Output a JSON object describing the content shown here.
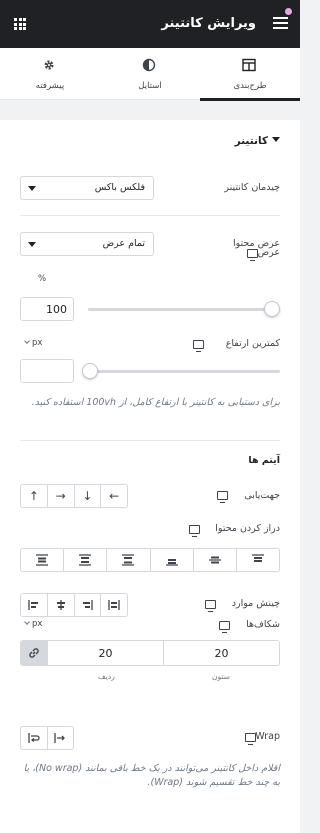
{
  "header": {
    "title": "ویرایش کانتینر"
  },
  "tabs": [
    {
      "label": "طرح‌بندی",
      "icon": "layout-icon",
      "active": true
    },
    {
      "label": "استایل",
      "icon": "contrast-icon",
      "active": false
    },
    {
      "label": "پیشرفته",
      "icon": "gear-icon",
      "active": false
    }
  ],
  "section": {
    "title": "کانتینر"
  },
  "container_layout": {
    "label": "چیدمان کانتینر",
    "value": "فلکس باکس"
  },
  "content_width": {
    "label": "عرض محتوا",
    "value": "تمام عرض"
  },
  "width": {
    "label": "عرض",
    "unit": "%",
    "value": "100",
    "slider_fraction": 1.0
  },
  "min_height": {
    "label": "کمترین ارتفاع",
    "unit": "px",
    "value": "",
    "slider_fraction": 0.0,
    "note": "برای دستیابی به کانتینر با ارتفاع کامل، از 100vh استفاده کنید."
  },
  "items": {
    "title": "آیتم ها",
    "direction_label": "جهت‌یابی",
    "direction_icons": [
      "arrow-up-icon",
      "arrow-right-icon",
      "arrow-down-icon",
      "arrow-left-icon"
    ],
    "justify_label": "دراز کردن محتوا",
    "justify_icons": [
      "justify-start-icon",
      "justify-center-icon",
      "justify-end-icon",
      "justify-space-between-icon",
      "justify-space-around-icon",
      "justify-space-evenly-icon"
    ],
    "align_label": "چینش موارد",
    "align_icons": [
      "align-start-icon",
      "align-center-icon",
      "align-end-icon",
      "align-stretch-icon"
    ]
  },
  "gaps": {
    "label": "شکاف‌ها",
    "unit": "px",
    "column": "20",
    "row": "20",
    "column_label": "ستون",
    "row_label": "ردیف"
  },
  "wrap": {
    "label": "Wrap",
    "note": "اقلام داخل کانتینر می‌توانند در یک خط باقی بمانند (No wrap)، یا به چند خط تقسیم شوند (Wrap)."
  }
}
